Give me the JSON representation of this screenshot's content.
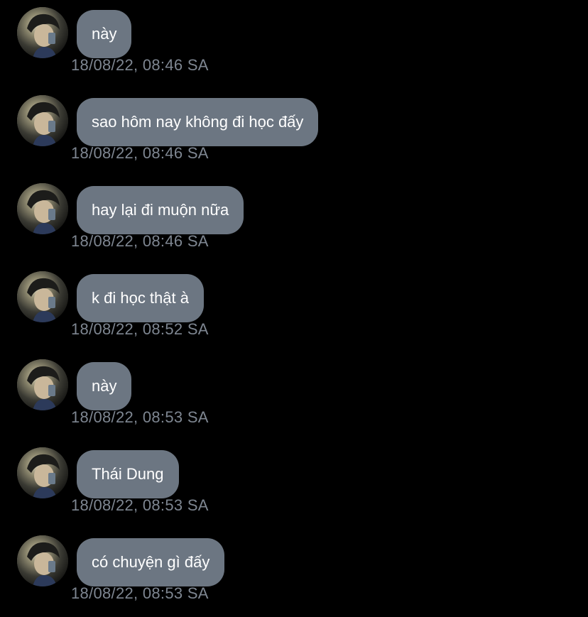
{
  "messages": [
    {
      "text": "này",
      "time": "18/08/22, 08:46 SA"
    },
    {
      "text": "sao hôm nay không đi học đấy",
      "time": "18/08/22, 08:46 SA"
    },
    {
      "text": "hay lại đi muộn nữa",
      "time": "18/08/22, 08:46 SA"
    },
    {
      "text": "k đi học thật à",
      "time": "18/08/22, 08:52 SA"
    },
    {
      "text": "này",
      "time": "18/08/22, 08:53 SA"
    },
    {
      "text": "Thái Dung",
      "time": "18/08/22, 08:53 SA"
    },
    {
      "text": "có chuyện gì đấy",
      "time": "18/08/22, 08:53 SA"
    }
  ],
  "colors": {
    "background": "#000000",
    "bubble": "#6c7682",
    "bubble_text": "#ffffff",
    "timestamp": "#7e8691"
  },
  "icons": {
    "avatar": "profile-photo"
  }
}
